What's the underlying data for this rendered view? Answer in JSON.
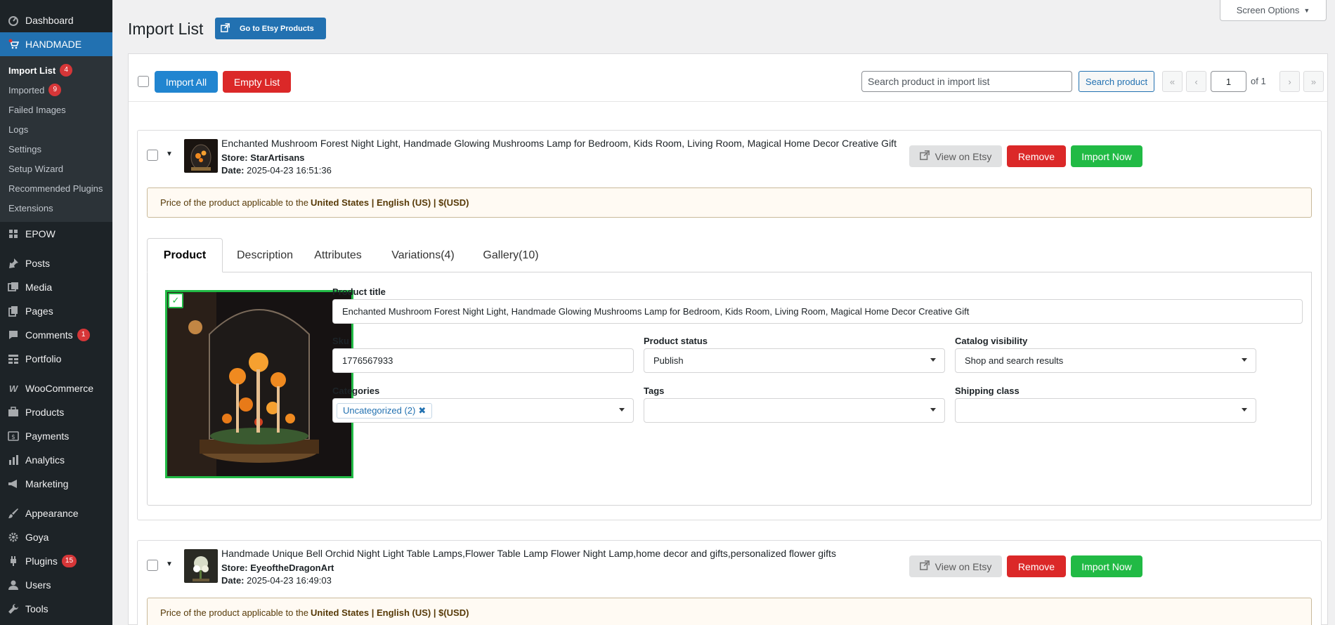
{
  "sidebar": {
    "items": [
      {
        "label": "Dashboard",
        "icon": "dashboard-icon"
      },
      {
        "label": "HANDMADE",
        "icon": "handmade-icon"
      },
      {
        "label": "EPOW",
        "icon": "grid-icon"
      },
      {
        "label": "Posts",
        "icon": "pin-icon"
      },
      {
        "label": "Media",
        "icon": "media-icon"
      },
      {
        "label": "Pages",
        "icon": "pages-icon"
      },
      {
        "label": "Comments",
        "icon": "comment-icon",
        "badge": "1"
      },
      {
        "label": "Portfolio",
        "icon": "portfolio-icon"
      },
      {
        "label": "WooCommerce",
        "icon": "woo-icon"
      },
      {
        "label": "Products",
        "icon": "products-icon"
      },
      {
        "label": "Payments",
        "icon": "payments-icon"
      },
      {
        "label": "Analytics",
        "icon": "analytics-icon"
      },
      {
        "label": "Marketing",
        "icon": "marketing-icon"
      },
      {
        "label": "Appearance",
        "icon": "brush-icon"
      },
      {
        "label": "Goya",
        "icon": "gear-icon"
      },
      {
        "label": "Plugins",
        "icon": "plugin-icon",
        "badge": "15"
      },
      {
        "label": "Users",
        "icon": "user-icon"
      },
      {
        "label": "Tools",
        "icon": "wrench-icon"
      }
    ],
    "submenu": [
      {
        "label": "Import List",
        "badge": "4"
      },
      {
        "label": "Imported",
        "badge": "9"
      },
      {
        "label": "Failed Images"
      },
      {
        "label": "Logs"
      },
      {
        "label": "Settings"
      },
      {
        "label": "Setup Wizard"
      },
      {
        "label": "Recommended Plugins"
      },
      {
        "label": "Extensions"
      }
    ]
  },
  "header": {
    "title": "Import List",
    "etsy_button": "Go to Etsy Products",
    "screen_options": "Screen Options"
  },
  "toolbar": {
    "import_all": "Import All",
    "empty_list": "Empty List",
    "search_placeholder": "Search product in import list",
    "search_button": "Search product",
    "page": "1",
    "of_pages": "of 1",
    "first": "«",
    "prev": "‹",
    "next": "›",
    "last": "»"
  },
  "items": [
    {
      "title": "Enchanted Mushroom Forest Night Light, Handmade Glowing Mushrooms Lamp for Bedroom, Kids Room, Living Room, Magical Home Decor Creative Gift",
      "store_label": "Store:",
      "store": "StarArtisans",
      "date_label": "Date:",
      "date": "2025-04-23 16:51:36",
      "view": "View on Etsy",
      "remove": "Remove",
      "import_now": "Import Now",
      "notice_prefix": "Price of the product applicable to the",
      "notice_region": "United States | English (US) | $(USD)"
    },
    {
      "title": "Handmade Unique Bell Orchid Night Light Table Lamps,Flower Table Lamp Flower Night Lamp,home decor and gifts,personalized flower gifts",
      "store_label": "Store:",
      "store": "EyeoftheDragonArt",
      "date_label": "Date:",
      "date": "2025-04-23 16:49:03",
      "view": "View on Etsy",
      "remove": "Remove",
      "import_now": "Import Now",
      "notice_prefix": "Price of the product applicable to the",
      "notice_region": "United States | English (US) | $(USD)"
    }
  ],
  "tabs": [
    "Product",
    "Description",
    "Attributes",
    "Variations(4)",
    "Gallery(10)"
  ],
  "form": {
    "title_label": "Product title",
    "title_value": "Enchanted Mushroom Forest Night Light, Handmade Glowing Mushrooms Lamp for Bedroom, Kids Room, Living Room, Magical Home Decor Creative Gift",
    "sku_label": "Sku",
    "sku_value": "1776567933",
    "status_label": "Product status",
    "status_value": "Publish",
    "visibility_label": "Catalog visibility",
    "visibility_value": "Shop and search results",
    "categories_label": "Categories",
    "category_chip": "Uncategorized (2)",
    "tags_label": "Tags",
    "shipping_label": "Shipping class",
    "image_check": "✓"
  },
  "colors": {
    "wp_blue": "#2271b1",
    "sidebar_bg": "#1d2327",
    "red": "#db2828",
    "green": "#21ba45"
  }
}
